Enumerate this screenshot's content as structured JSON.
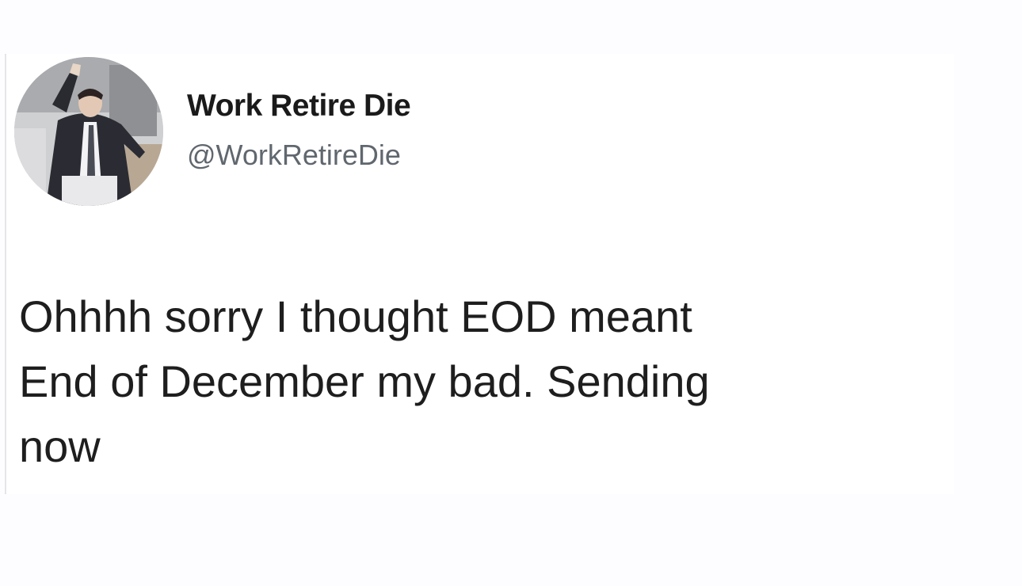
{
  "tweet": {
    "avatar_icon": "profile-photo-man-in-suit-dancing",
    "display_name": "Work Retire Die",
    "handle": "@WorkRetireDie",
    "text_lines": [
      "Ohhhh sorry I thought EOD meant",
      "End of December my bad. Sending",
      "now"
    ]
  }
}
